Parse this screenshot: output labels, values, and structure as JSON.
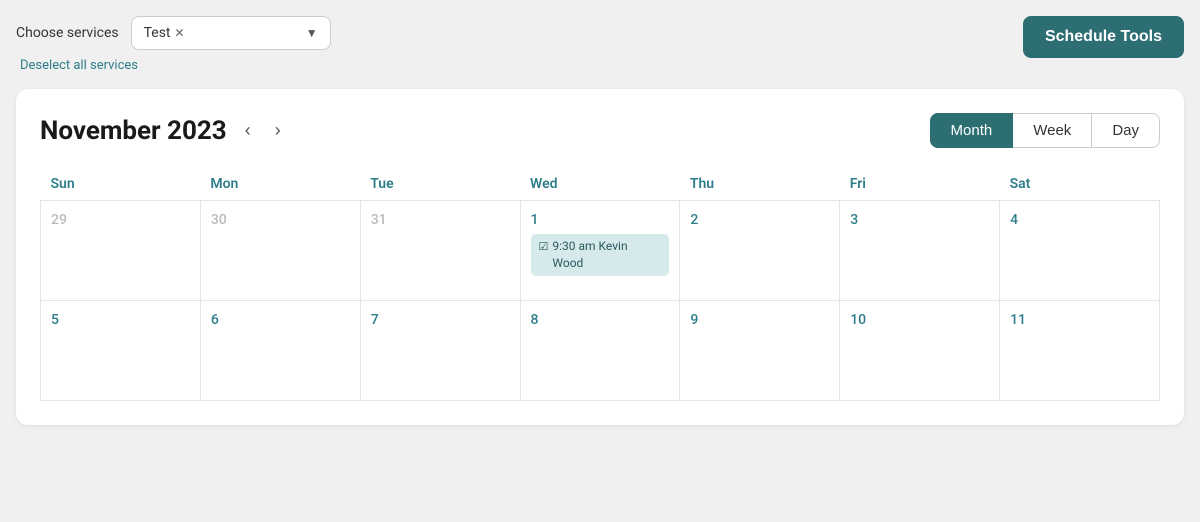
{
  "header": {
    "choose_services_label": "Choose services",
    "selected_service": "Test",
    "deselect_label": "Deselect all services",
    "schedule_tools_label": "Schedule Tools"
  },
  "calendar": {
    "title": "November 2023",
    "views": [
      "Month",
      "Week",
      "Day"
    ],
    "active_view": "Month",
    "days_of_week": [
      "Sun",
      "Mon",
      "Tue",
      "Wed",
      "Thu",
      "Fri",
      "Sat"
    ],
    "weeks": [
      [
        {
          "date": "29",
          "outside": true
        },
        {
          "date": "30",
          "outside": true
        },
        {
          "date": "31",
          "outside": true
        },
        {
          "date": "1",
          "outside": false,
          "events": [
            {
              "time": "9:30 am",
              "name": "Kevin Wood"
            }
          ]
        },
        {
          "date": "2",
          "outside": false
        },
        {
          "date": "3",
          "outside": false
        },
        {
          "date": "4",
          "outside": false
        }
      ],
      [
        {
          "date": "5",
          "outside": false
        },
        {
          "date": "6",
          "outside": false
        },
        {
          "date": "7",
          "outside": false
        },
        {
          "date": "8",
          "outside": false
        },
        {
          "date": "9",
          "outside": false
        },
        {
          "date": "10",
          "outside": false
        },
        {
          "date": "11",
          "outside": false
        }
      ]
    ]
  }
}
